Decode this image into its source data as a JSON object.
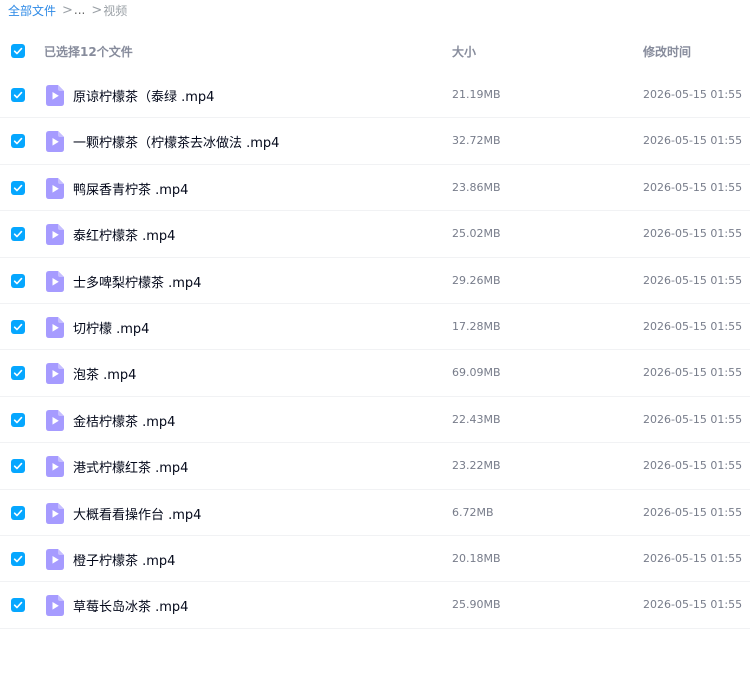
{
  "breadcrumb": {
    "root": "全部文件",
    "sep": ">",
    "ellipsis": "...",
    "current": "视频"
  },
  "header": {
    "selected_text": "已选择12个文件",
    "col_size": "大小",
    "col_time": "修改时间",
    "all_checked": true
  },
  "colors": {
    "accent": "#06a7ff",
    "video_icon": "#a69bff",
    "link": "#2e8ae6"
  },
  "icons": {
    "checkbox": "checkmark-icon",
    "file": "video-file-icon"
  },
  "files": [
    {
      "name": "原谅柠檬茶（泰绿 .mp4",
      "size": "21.19MB",
      "time": "2026-05-15 01:55",
      "checked": true
    },
    {
      "name": "一颗柠檬茶（柠檬茶去冰做法 .mp4",
      "size": "32.72MB",
      "time": "2026-05-15 01:55",
      "checked": true
    },
    {
      "name": "鸭屎香青柠茶 .mp4",
      "size": "23.86MB",
      "time": "2026-05-15 01:55",
      "checked": true
    },
    {
      "name": "泰红柠檬茶 .mp4",
      "size": "25.02MB",
      "time": "2026-05-15 01:55",
      "checked": true
    },
    {
      "name": "士多啤梨柠檬茶 .mp4",
      "size": "29.26MB",
      "time": "2026-05-15 01:55",
      "checked": true
    },
    {
      "name": "切柠檬 .mp4",
      "size": "17.28MB",
      "time": "2026-05-15 01:55",
      "checked": true
    },
    {
      "name": "泡茶 .mp4",
      "size": "69.09MB",
      "time": "2026-05-15 01:55",
      "checked": true
    },
    {
      "name": "金桔柠檬茶 .mp4",
      "size": "22.43MB",
      "time": "2026-05-15 01:55",
      "checked": true
    },
    {
      "name": "港式柠檬红茶 .mp4",
      "size": "23.22MB",
      "time": "2026-05-15 01:55",
      "checked": true
    },
    {
      "name": "大概看看操作台 .mp4",
      "size": "6.72MB",
      "time": "2026-05-15 01:55",
      "checked": true
    },
    {
      "name": "橙子柠檬茶 .mp4",
      "size": "20.18MB",
      "time": "2026-05-15 01:55",
      "checked": true
    },
    {
      "name": "草莓长岛冰茶 .mp4",
      "size": "25.90MB",
      "time": "2026-05-15 01:55",
      "checked": true
    }
  ]
}
